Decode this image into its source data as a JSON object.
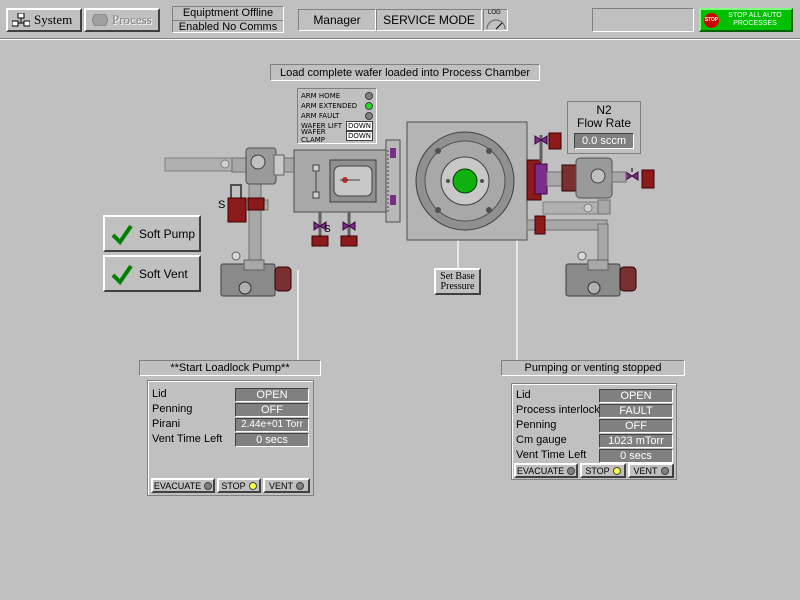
{
  "toolbar": {
    "system_label": "System",
    "process_label": "Process",
    "status_line1": "Equiptment Offline",
    "status_line2": "Enabled No Comms",
    "user_label": "Manager",
    "mode_label": "SERVICE MODE",
    "log_label": "LOG",
    "stop_badge": "STOP",
    "stop_label": "STOP ALL AUTO PROCESSES"
  },
  "status_message": "Load complete wafer loaded into Process Chamber",
  "arm_status": {
    "items": [
      {
        "label": "ARM HOME",
        "state": "off"
      },
      {
        "label": "ARM EXTENDED",
        "state": "on"
      },
      {
        "label": "ARM FAULT",
        "state": "off"
      },
      {
        "label": "WAFER LIFT",
        "value": "DOWN"
      },
      {
        "label": "WAFER CLAMP",
        "value": "DOWN"
      }
    ]
  },
  "n2": {
    "title_line1": "N2",
    "title_line2": "Flow Rate",
    "value": "0.0 sccm"
  },
  "valve_marks": {
    "left_s": "S",
    "loadlock_s": "S"
  },
  "soft_pump_label": "Soft Pump",
  "soft_vent_label": "Soft Vent",
  "set_base_label_line1": "Set Base",
  "set_base_label_line2": "Pressure",
  "loadlock": {
    "title": "**Start Loadlock Pump**",
    "rows": [
      {
        "label": "Lid",
        "value": "OPEN"
      },
      {
        "label": "Penning",
        "value": "OFF"
      },
      {
        "label": "Pirani",
        "value": "2.44e+01 Torr"
      },
      {
        "label": "Vent Time Left",
        "value": "0 secs"
      }
    ],
    "buttons": {
      "evacuate": "EVACUATE",
      "stop": "STOP",
      "vent": "VENT"
    }
  },
  "chamber": {
    "title": "Pumping or venting stopped",
    "rows": [
      {
        "label": "Lid",
        "value": "OPEN"
      },
      {
        "label": "Process interlock",
        "value": "FAULT"
      },
      {
        "label": "Penning",
        "value": "OFF"
      },
      {
        "label": "Cm gauge",
        "value": "1023 mTorr"
      },
      {
        "label": "Vent Time Left",
        "value": "0 secs"
      }
    ],
    "buttons": {
      "evacuate": "EVACUATE",
      "stop": "STOP",
      "vent": "VENT"
    }
  },
  "colors": {
    "led_on": "#22dd22",
    "led_off": "#808080",
    "stop_green": "#00c000",
    "valve_red": "#8b1a1a",
    "valve_purple": "#7a2d8a"
  }
}
